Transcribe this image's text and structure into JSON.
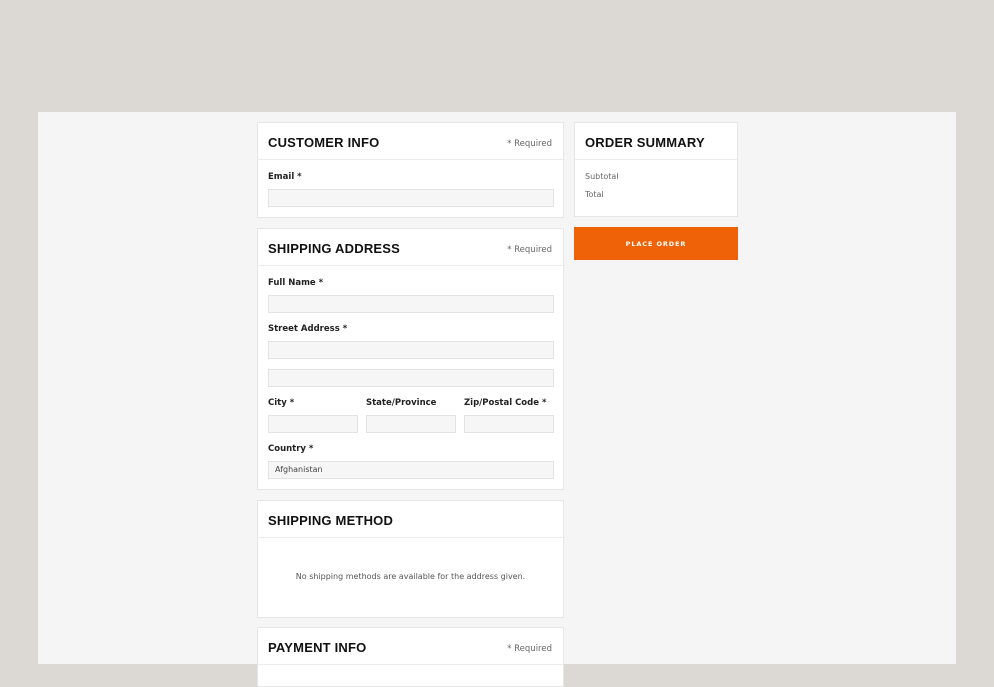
{
  "customer_info": {
    "title": "CUSTOMER INFO",
    "required_note": "* Required",
    "email_label": "Email *",
    "email_value": ""
  },
  "shipping_address": {
    "title": "SHIPPING ADDRESS",
    "required_note": "* Required",
    "full_name_label": "Full Name *",
    "street_label": "Street Address *",
    "city_label": "City *",
    "state_label": "State/Province",
    "zip_label": "Zip/Postal Code *",
    "country_label": "Country *",
    "country_value": "Afghanistan"
  },
  "shipping_method": {
    "title": "SHIPPING METHOD",
    "message": "No shipping methods are available for the address given."
  },
  "payment_info": {
    "title": "PAYMENT INFO",
    "required_note": "* Required"
  },
  "order_summary": {
    "title": "ORDER SUMMARY",
    "subtotal_label": "Subtotal",
    "total_label": "Total"
  },
  "place_order": {
    "label": "PLACE ORDER"
  },
  "colors": {
    "accent": "#ef6207",
    "page_bg": "#dcd8d4",
    "content_bg": "#f5f5f5"
  }
}
